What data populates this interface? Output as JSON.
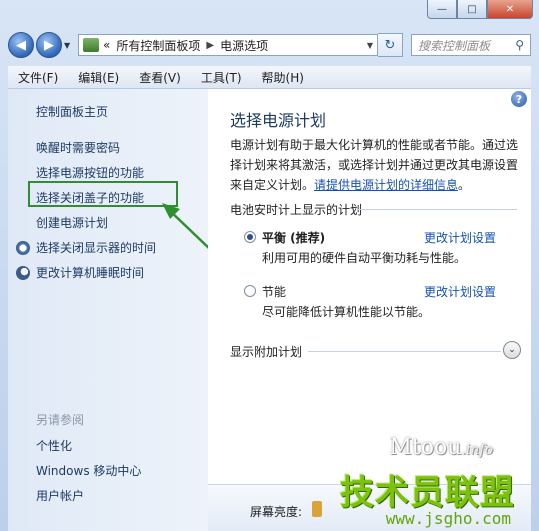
{
  "window": {
    "minimize": "—",
    "maximize": "□",
    "close": "✕"
  },
  "nav": {
    "back": "◀",
    "forward": "▶",
    "breadcrumb_overflow": "«",
    "crumb1": "所有控制面板项",
    "crumb2": "电源选项",
    "search_placeholder": "搜索控制面板"
  },
  "menu": [
    "文件(F)",
    "编辑(E)",
    "查看(V)",
    "工具(T)",
    "帮助(H)"
  ],
  "sidebar": {
    "home": "控制面板主页",
    "items": [
      "唤醒时需要密码",
      "选择电源按钮的功能",
      "选择关闭盖子的功能",
      "创建电源计划"
    ],
    "icon_items": [
      {
        "label": "选择关闭显示器的时间",
        "icon": "clock-icon"
      },
      {
        "label": "更改计算机睡眠时间",
        "icon": "moon-icon"
      }
    ],
    "see_also_title": "另请参阅",
    "see_also": [
      "个性化",
      "Windows 移动中心",
      "用户帐户"
    ]
  },
  "main": {
    "help": "?",
    "title": "选择电源计划",
    "desc_line1": "电源计划有助于最大化计算机的性能或者节能。通过选",
    "desc_line2": "择计划来将其激活，或选择计划并通过更改其电源设置",
    "desc_line3": "来自定义计划。",
    "desc_link": "请提供电源计划的详细信息",
    "desc_end": "。",
    "group_title": "电池安时计上显示的计划",
    "plans": [
      {
        "name": "平衡 (推荐)",
        "desc": "利用可用的硬件自动平衡功耗与性能。",
        "change": "更改计划设置",
        "selected": true
      },
      {
        "name": "节能",
        "desc": "尽可能降低计算机性能以节能。",
        "change": "更改计划设置",
        "selected": false
      }
    ],
    "more_plans": "显示附加计划",
    "expand": "⌄"
  },
  "bottom": {
    "brightness_label": "屏幕亮度:"
  },
  "watermark": {
    "top": "Mtoou",
    "top_domain": ".info",
    "main": "技术员联盟",
    "url": "www.jsgho.com"
  },
  "colors": {
    "highlight_box": "#2f8f2f",
    "link": "#1451b5"
  }
}
